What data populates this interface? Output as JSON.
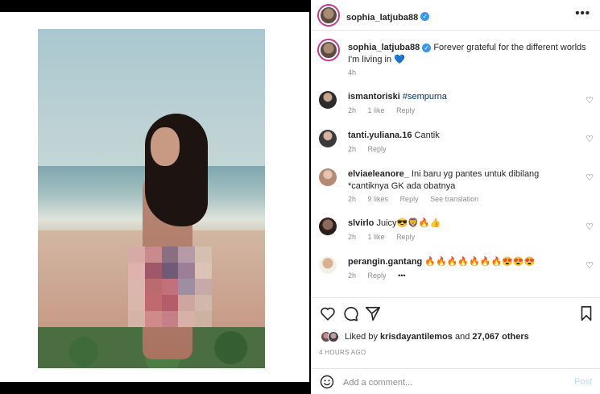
{
  "post": {
    "username": "sophia_latjuba88",
    "verified": true,
    "caption": "Forever grateful for the different worlds I'm living in",
    "caption_emoji": "💙",
    "caption_time": "4h"
  },
  "comments": [
    {
      "username": "ismantoriski",
      "text": "#sempurna",
      "time": "2h",
      "likes": "1 like",
      "reply": "Reply"
    },
    {
      "username": "tanti.yuliana.16",
      "text": "Cantik",
      "time": "2h",
      "likes": "",
      "reply": "Reply"
    },
    {
      "username": "elviaeleanore_",
      "text": "Ini baru yg pantes untuk dibilang *cantiknya GK ada obatnya",
      "time": "2h",
      "likes": "9 likes",
      "reply": "Reply",
      "translation": "See translation"
    },
    {
      "username": "slvirlo",
      "text": "Juicy😎🦁🔥👍",
      "time": "2h",
      "likes": "1 like",
      "reply": "Reply"
    },
    {
      "username": "perangin.gantang",
      "text": "🔥🔥🔥🔥🔥🔥🔥😍😍😍",
      "time": "2h",
      "likes": "",
      "reply": "Reply",
      "more": "•••"
    }
  ],
  "likes_summary": {
    "prefix": "Liked by",
    "user": "krisdayantilemos",
    "joiner": "and",
    "others": "27,067 others"
  },
  "timestamp": "4 HOURS AGO",
  "add_comment": {
    "placeholder": "Add a comment...",
    "post_label": "Post"
  },
  "icons": [
    "heart-icon",
    "comment-icon",
    "share-icon",
    "bookmark-icon",
    "emoji-icon",
    "more-options-icon",
    "verified-badge-icon"
  ],
  "colors": {
    "verified": "#3797f0",
    "link": "#00376b",
    "post_disabled": "#b2dffc",
    "muted": "#8e8e8e"
  }
}
